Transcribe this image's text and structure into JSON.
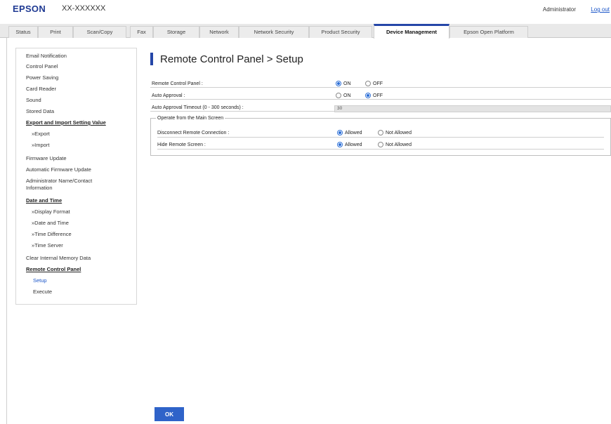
{
  "header": {
    "brand": "EPSON",
    "model": "XX-XXXXXX",
    "admin_label": "Administrator",
    "logout_label": "Log out"
  },
  "tabs": [
    {
      "label": "Status"
    },
    {
      "label": "Print"
    },
    {
      "label": "Scan/Copy"
    },
    {
      "label": "Fax"
    },
    {
      "label": "Storage"
    },
    {
      "label": "Network"
    },
    {
      "label": "Network Security"
    },
    {
      "label": "Product Security"
    },
    {
      "label": "Device Management",
      "active": true
    },
    {
      "label": "Epson Open Platform"
    }
  ],
  "sidebar": {
    "items": [
      {
        "label": "Email Notification"
      },
      {
        "label": "Control Panel"
      },
      {
        "label": "Power Saving"
      },
      {
        "label": "Card Reader"
      },
      {
        "label": "Sound"
      },
      {
        "label": "Stored Data"
      },
      {
        "label": "Export and Import Setting Value"
      },
      {
        "label": "»Export"
      },
      {
        "label": "»Import"
      },
      {
        "label": "Firmware Update"
      },
      {
        "label": "Automatic Firmware Update"
      },
      {
        "label": "Administrator Name/Contact"
      },
      {
        "label": "Information"
      },
      {
        "label": "Date and Time"
      },
      {
        "label": "»Display Format"
      },
      {
        "label": "»Date and Time"
      },
      {
        "label": "»Time Difference"
      },
      {
        "label": "»Time Server"
      },
      {
        "label": "Clear Internal Memory Data"
      },
      {
        "label": "Remote Control Panel"
      },
      {
        "label": "Setup"
      },
      {
        "label": "Execute"
      }
    ]
  },
  "main": {
    "title": "Remote Control Panel > Setup",
    "rows": {
      "remote_control_panel": {
        "label": "Remote Control Panel :",
        "on_label": "ON",
        "off_label": "OFF",
        "value": "ON"
      },
      "auto_approval": {
        "label": "Auto Approval :",
        "on_label": "ON",
        "off_label": "OFF",
        "value": "OFF"
      },
      "auto_approval_timeout": {
        "label": "Auto Approval Timeout (0 - 300 seconds) :",
        "value": "30"
      }
    },
    "fieldset": {
      "legend": "Operate from the Main Screen",
      "disconnect": {
        "label": "Disconnect Remote Connection :",
        "allowed_label": "Allowed",
        "not_allowed_label": "Not Allowed",
        "value": "Allowed"
      },
      "hide_screen": {
        "label": "Hide Remote Screen :",
        "allowed_label": "Allowed",
        "not_allowed_label": "Not Allowed",
        "value": "Allowed"
      }
    },
    "ok_label": "OK"
  },
  "colors": {
    "brand": "#1f3a93",
    "accent": "#2546a8",
    "button": "#2f63c9",
    "link": "#1a55c8"
  }
}
